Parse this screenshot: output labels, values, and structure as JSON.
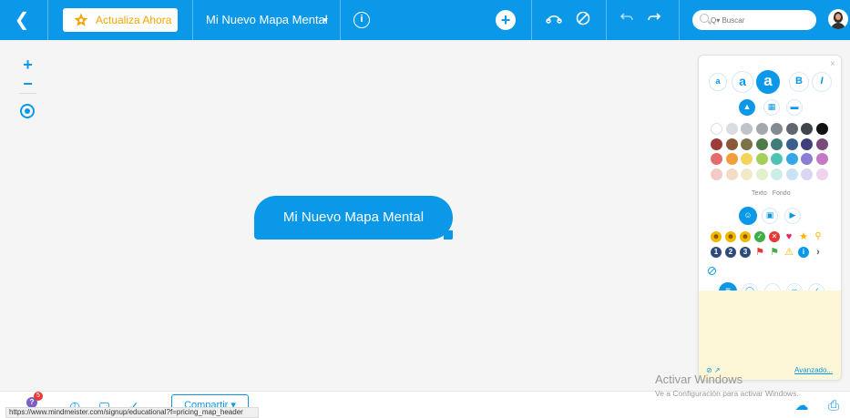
{
  "topbar": {
    "upgrade_label": "Actualiza Ahora",
    "map_title": "Mi Nuevo Mapa Mental",
    "info_glyph": "i",
    "add_glyph": "+",
    "search_placeholder": "Q▾ Buscar"
  },
  "canvas": {
    "zoom_in": "+",
    "zoom_out": "−",
    "root_node": "Mi Nuevo Mapa Mental"
  },
  "panel": {
    "close": "×",
    "font_buttons": [
      "a",
      "a",
      "a",
      "B",
      "I"
    ],
    "color_tab_texto": "Texto",
    "color_tab_fondo": "Fondo",
    "icon_row2_more": "›",
    "advanced_link": "Avanzado...",
    "colors": {
      "row1": [
        "#ffffff",
        "#d9dde2",
        "#bfc4ca",
        "#a2a8ae",
        "#838a91",
        "#5f666d",
        "#3f454b",
        "#111111"
      ],
      "row2": [
        "#9c3b3b",
        "#8a5a3a",
        "#7b7348",
        "#4f7a4a",
        "#3e7b7a",
        "#3b5e8d",
        "#3f3f7a",
        "#7a4a7a"
      ],
      "row3": [
        "#e26b6b",
        "#f29d3c",
        "#f3d35a",
        "#a5cf5a",
        "#4cc3b3",
        "#36a7e6",
        "#8b7cd4",
        "#c278c2"
      ],
      "row4": [
        "#f2cbc6",
        "#f2dcc6",
        "#f2eac6",
        "#e2f0cc",
        "#cceee8",
        "#c9e3f5",
        "#dcd5f2",
        "#f0d3ec"
      ]
    }
  },
  "bottom": {
    "help_badge": "5",
    "help_glyph": "?",
    "share_label": "Compartir ▾",
    "status_url": "https://www.mindmeister.com/signup/educational?f=pricing_map_header"
  },
  "watermark": {
    "line1": "Activar Windows",
    "line2": "Ve a Configuración para activar Windows."
  },
  "accent_color": "#0b98e9"
}
